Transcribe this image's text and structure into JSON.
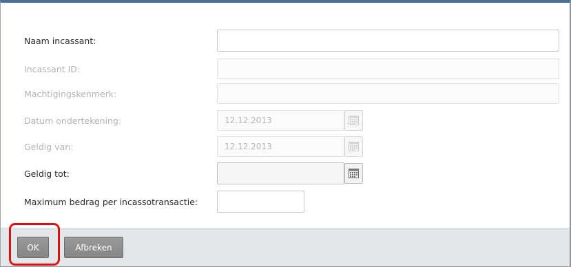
{
  "form": {
    "fields": [
      {
        "label": "Naam incassant:",
        "value": "",
        "state": "active"
      },
      {
        "label": "Incassant ID:",
        "value": "",
        "state": "disabled"
      },
      {
        "label": "Machtigingskenmerk:",
        "value": "",
        "state": "disabled"
      },
      {
        "label": "Datum ondertekening:",
        "value": "12.12.2013",
        "state": "disabled",
        "icon": "calendar-icon"
      },
      {
        "label": "Geldig van:",
        "value": "12.12.2013",
        "state": "disabled",
        "icon": "calendar-icon"
      },
      {
        "label": "Geldig tot:",
        "value": "",
        "state": "active",
        "icon": "calendar-icon"
      },
      {
        "label": "Maximum bedrag per incassotransactie:",
        "value": "",
        "state": "active"
      }
    ]
  },
  "footer": {
    "ok_label": "OK",
    "cancel_label": "Afbreken"
  },
  "colors": {
    "accent_top_border": "#4a6f95",
    "highlight": "#e01010",
    "button": "#8f8f8f"
  }
}
